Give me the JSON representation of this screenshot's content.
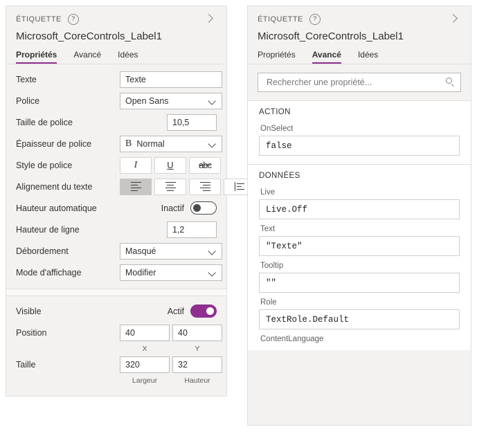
{
  "colors": {
    "accent": "#8f2f8f",
    "panel_bg": "#f3f2f1",
    "border": "#e1dfdd",
    "input_border": "#bcbab8",
    "text": "#323130",
    "muted": "#605e5c"
  },
  "left_panel": {
    "header": {
      "kind": "ÉTIQUETTE",
      "help_icon": "question-circle-icon",
      "collapse_icon": "chevron-right-icon",
      "control_name": "Microsoft_CoreControls_Label1"
    },
    "tabs": [
      {
        "label": "Propriétés",
        "active": true
      },
      {
        "label": "Avancé",
        "active": false
      },
      {
        "label": "Idées",
        "active": false
      }
    ],
    "rows": [
      {
        "label": "Texte",
        "type": "text",
        "value": "Texte"
      },
      {
        "label": "Police",
        "type": "dropdown",
        "value": "Open Sans"
      },
      {
        "label": "Taille de police",
        "type": "number",
        "value": "10,5"
      },
      {
        "label": "Épaisseur de police",
        "type": "dropdown-bold",
        "value": "Normal",
        "prefix": "B"
      },
      {
        "label": "Style de police",
        "type": "style-buttons",
        "buttons": [
          {
            "name": "italic-button",
            "glyph": "I",
            "selected": false
          },
          {
            "name": "underline-button",
            "glyph": "U",
            "selected": false
          },
          {
            "name": "strikethrough-button",
            "glyph": "abc",
            "selected": false
          }
        ]
      },
      {
        "label": "Alignement du texte",
        "type": "align-buttons",
        "buttons": [
          {
            "name": "align-left-button",
            "selected": true
          },
          {
            "name": "align-center-button",
            "selected": false
          },
          {
            "name": "align-right-button",
            "selected": false
          },
          {
            "name": "align-justify-button",
            "selected": false
          }
        ]
      },
      {
        "label": "Hauteur automatique",
        "type": "toggle",
        "state_label": "Inactif",
        "on": false
      },
      {
        "label": "Hauteur de ligne",
        "type": "number",
        "value": "1,2"
      },
      {
        "label": "Débordement",
        "type": "dropdown",
        "value": "Masqué"
      },
      {
        "label": "Mode d'affichage",
        "type": "dropdown",
        "value": "Modifier"
      }
    ],
    "section2": {
      "visible": {
        "label": "Visible",
        "state_label": "Actif",
        "on": true
      },
      "position": {
        "label": "Position",
        "x": "40",
        "y": "40",
        "x_caption": "X",
        "y_caption": "Y"
      },
      "size": {
        "label": "Taille",
        "w": "320",
        "h": "32",
        "w_caption": "Largeur",
        "h_caption": "Hauteur"
      }
    }
  },
  "right_panel": {
    "header": {
      "kind": "ÉTIQUETTE",
      "help_icon": "question-circle-icon",
      "collapse_icon": "chevron-right-icon",
      "control_name": "Microsoft_CoreControls_Label1"
    },
    "tabs": [
      {
        "label": "Propriétés",
        "active": false
      },
      {
        "label": "Avancé",
        "active": true
      },
      {
        "label": "Idées",
        "active": false
      }
    ],
    "search": {
      "placeholder": "Rechercher une propriété...",
      "value": "",
      "icon": "search-icon"
    },
    "sections": [
      {
        "title": "ACTION",
        "properties": [
          {
            "name": "OnSelect",
            "value": "false"
          }
        ]
      },
      {
        "title": "DONNÉES",
        "properties": [
          {
            "name": "Live",
            "value": "Live.Off"
          },
          {
            "name": "Text",
            "value": "\"Texte\""
          },
          {
            "name": "Tooltip",
            "value": "\"\""
          },
          {
            "name": "Role",
            "value": "TextRole.Default"
          },
          {
            "name": "ContentLanguage",
            "value": ""
          }
        ]
      }
    ]
  }
}
